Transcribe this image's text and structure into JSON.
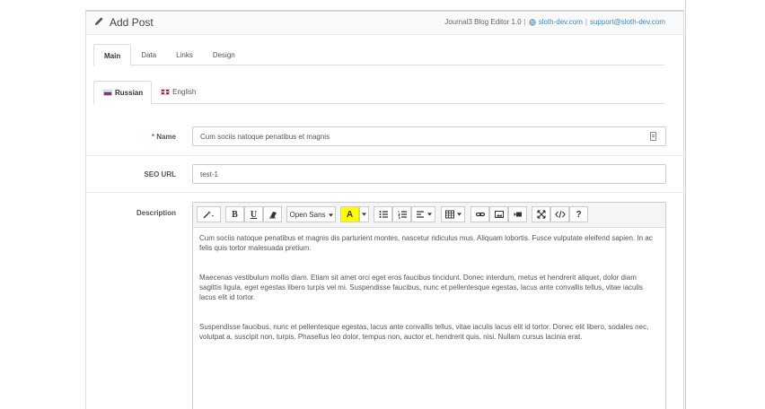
{
  "header": {
    "title": "Add Post",
    "editor_name": "Journal3 Blog Editor 1.0",
    "separator": "|",
    "site_link": "sloth-dev.com",
    "support_link": "support@sloth-dev.com"
  },
  "tabs": [
    {
      "label": "Main",
      "active": true
    },
    {
      "label": "Data",
      "active": false
    },
    {
      "label": "Links",
      "active": false
    },
    {
      "label": "Design",
      "active": false
    }
  ],
  "languages": [
    {
      "label": "Russian",
      "active": true
    },
    {
      "label": "English",
      "active": false
    }
  ],
  "form": {
    "required_mark": "*",
    "name_label": "Name",
    "name_value": "Cum sociis natoque penatibus et magnis",
    "seo_label": "SEO URL",
    "seo_value": "test-1",
    "description_label": "Description"
  },
  "toolbar": {
    "font_family": "Open Sans",
    "bold": "B",
    "underline": "U",
    "font_color": "A",
    "help": "?",
    "colors": {
      "highlight": "#ffff00"
    }
  },
  "editor": {
    "paragraphs": [
      "Cum sociis natoque penatibus et magnis dis parturient montes, nascetur ridiculus mus. Aliquam lobortis. Fusce vulputate eleifend sapien. In ac felis quis tortor malesuada pretium.",
      "Maecenas vestibulum mollis diam. Etiam sit amet orci eget eros faucibus tincidunt. Donec interdum, metus et hendrerit aliquet, dolor diam sagittis ligula, eget egestas libero turpis vel mi. Suspendisse faucibus, nunc et pellentesque egestas, lacus ante convallis tellus, vitae iaculis lacus elit id tortor.",
      "Suspendisse faucibus, nunc et pellentesque egestas, lacus ante convallis tellus, vitae iaculis lacus elit id tortor. Donec elit libero, sodales nec, volutpat a, suscipit non, turpis. Phasellus leo dolor, tempus non, auctor et, hendrerit quis, nisi. Nullam cursus lacinia erat."
    ]
  },
  "colors": {
    "link": "#3a8cc6",
    "required": "#e04b4b"
  }
}
